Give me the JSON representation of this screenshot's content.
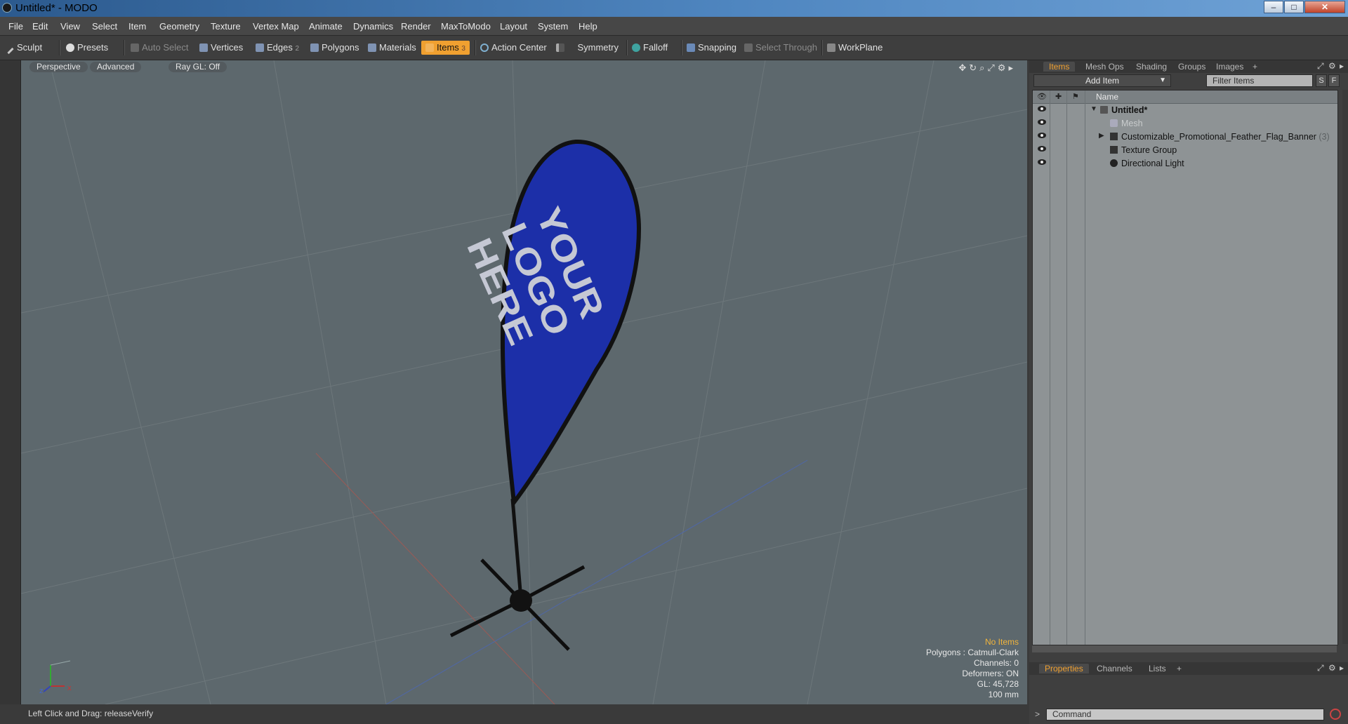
{
  "window": {
    "title": "Untitled* - MODO",
    "minimize": "–",
    "maximize": "□",
    "close": "✕"
  },
  "menu": [
    "File",
    "Edit",
    "View",
    "Select",
    "Item",
    "Geometry",
    "Texture",
    "Vertex Map",
    "Animate",
    "Dynamics",
    "Render",
    "MaxToModo",
    "Layout",
    "System",
    "Help"
  ],
  "toolbar": {
    "sculpt": "Sculpt",
    "presets": "Presets",
    "auto_select": "Auto Select",
    "vertices": "Vertices",
    "edges": "Edges",
    "edges_count": "2",
    "polygons": "Polygons",
    "materials": "Materials",
    "items": "Items",
    "items_count": "3",
    "action_center": "Action Center",
    "symmetry": "Symmetry",
    "falloff": "Falloff",
    "snapping": "Snapping",
    "select_through": "Select Through",
    "workplane": "WorkPlane"
  },
  "viewport": {
    "tabs": [
      "Perspective",
      "Advanced",
      "Ray GL: Off"
    ],
    "flag_text": [
      "YOUR",
      "LOGO",
      "HERE"
    ],
    "info": {
      "no_items": "No Items",
      "polygons": "Polygons : Catmull-Clark",
      "channels": "Channels: 0",
      "deformers": "Deformers: ON",
      "gl": "GL: 45,728",
      "size": "100 mm"
    },
    "axis": {
      "x": "x",
      "z": "z"
    }
  },
  "status": {
    "message": "Left Click and Drag:  releaseVerify"
  },
  "right_panel": {
    "top_tabs": [
      "Items",
      "Mesh Ops",
      "Shading",
      "Groups",
      "Images"
    ],
    "add_tab": "+",
    "add_item": "Add Item",
    "filter_placeholder": "Filter Items",
    "s_button": "S",
    "f_button": "F",
    "column_name": "Name",
    "tree": [
      {
        "label": "Untitled*",
        "count": ""
      },
      {
        "label": "Mesh",
        "count": ""
      },
      {
        "label": "Customizable_Promotional_Feather_Flag_Banner",
        "count": "(3)"
      },
      {
        "label": "Texture Group",
        "count": ""
      },
      {
        "label": "Directional Light",
        "count": ""
      }
    ],
    "bottom_tabs": [
      "Properties",
      "Channels",
      "Lists"
    ],
    "command_placeholder": "Command"
  },
  "colors": {
    "accent": "#f0a030",
    "flag_blue": "#1c2fa8",
    "viewport_bg": "#5d686d"
  }
}
